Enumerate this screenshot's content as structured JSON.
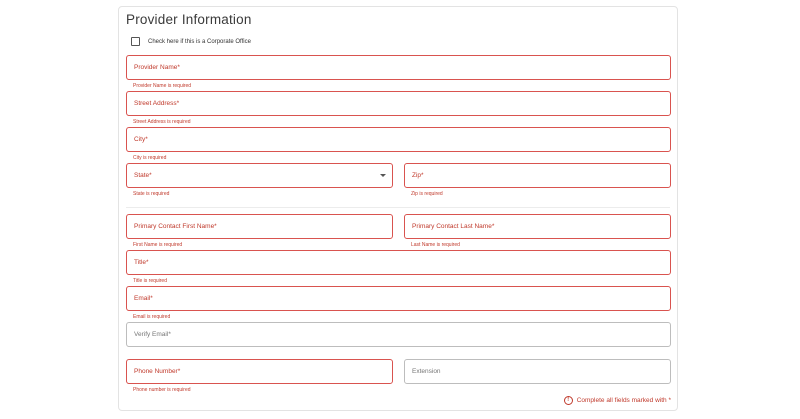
{
  "form": {
    "title": "Provider Information",
    "corporate_checkbox_label": "Check here if this is a Corporate Office",
    "fields": {
      "provider_name": {
        "placeholder": "Provider Name*",
        "error": "Provider Name is required"
      },
      "street_address": {
        "placeholder": "Street Address*",
        "error": "Street Address is required"
      },
      "city": {
        "placeholder": "City*",
        "error": "City is required"
      },
      "state": {
        "placeholder": "State*",
        "error": "State is required"
      },
      "zip": {
        "placeholder": "Zip*",
        "error": "Zip is required"
      },
      "first_name": {
        "placeholder": "Primary Contact First Name*",
        "error": "First Name is required"
      },
      "last_name": {
        "placeholder": "Primary Contact Last Name*",
        "error": "Last Name is required"
      },
      "title": {
        "placeholder": "Title*",
        "error": "Title is required"
      },
      "email": {
        "placeholder": "Email*",
        "error": "Email is required"
      },
      "verify_email": {
        "placeholder": "Verify Email*"
      },
      "phone": {
        "placeholder": "Phone Number*",
        "error": "Phone number is required"
      },
      "extension": {
        "placeholder": "Extension"
      }
    },
    "footer_note": "Complete all fields marked with *",
    "warning_icon_glyph": "!",
    "colors": {
      "error": "#c0392b",
      "error_border": "#d9534f"
    }
  }
}
